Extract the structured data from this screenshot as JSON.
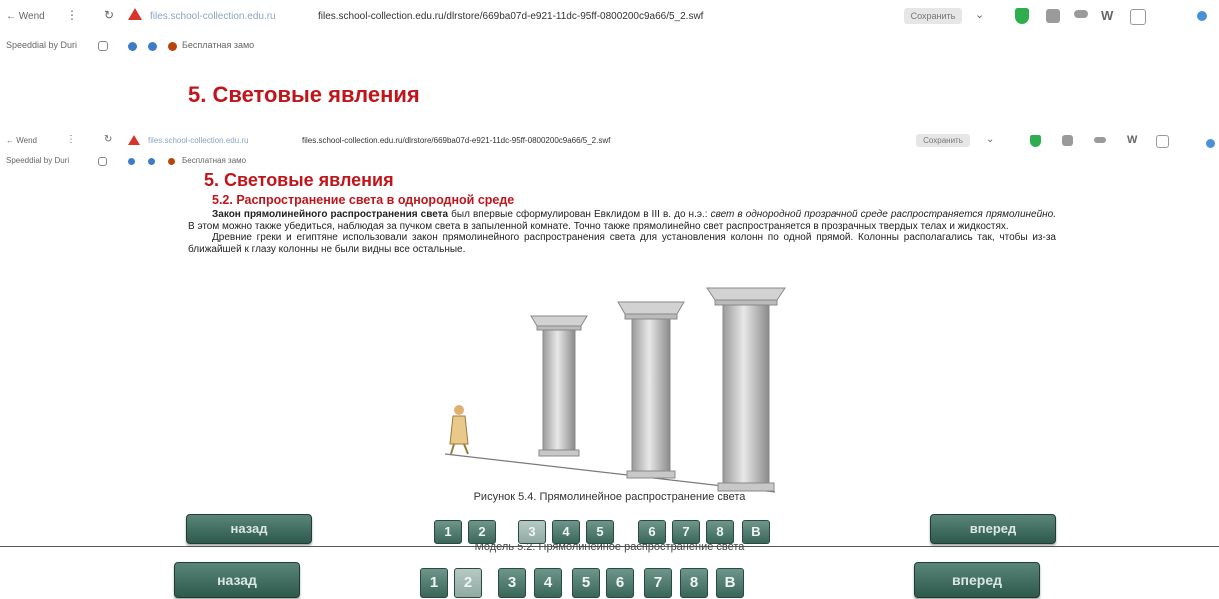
{
  "browser": {
    "back_label": "← Wend",
    "url_host": "files.school-collection.edu.ru",
    "url": "files.school-collection.edu.ru/dlrstore/669ba07d-e921-11dc-95ff-0800200c9a66/5_2.swf",
    "save_label": "Сохранить",
    "bookmarks": [
      {
        "label": "Speeddial by Duri"
      },
      {
        "label": "Бесплатная замо"
      }
    ],
    "colors": {
      "warning": "#d9342b",
      "shield": "#2fae4e"
    }
  },
  "page": {
    "title": "5. Световые явления",
    "subtitle": "5.2. Распространение света в однородной среде",
    "para1_bold": "Закон прямолинейного распространения света",
    "para1_rest": " был впервые сформулирован Евклидом в III в. до н.э.: ",
    "para1_italic": "свет в однородной прозрачной среде распространяется прямолинейно.",
    "para1_end": " В этом можно также убедиться, наблюдая за пучком света в запыленной комнате. Точно также прямолинейно свет распространяется в прозрачных твердых телах и жидкостях.",
    "para2": "Древние греки и египтяне использовали закон прямолинейного распространения света для установления колонн по одной прямой. Колонны располагались так, чтобы из-за ближайшей к глазу колонны не были видны все остальные.",
    "caption": "Рисунок 5.4. Прямолинейное распространение света",
    "caption2": "Модель 5.2. Прямолинейное распространение света"
  },
  "nav": {
    "back_label": "назад",
    "forward_label": "вперед",
    "pages": [
      "1",
      "2",
      "3",
      "4",
      "5",
      "6",
      "7",
      "8",
      "В"
    ],
    "current_upper": "3",
    "current_lower": "2",
    "button_color": "#3a665a"
  }
}
